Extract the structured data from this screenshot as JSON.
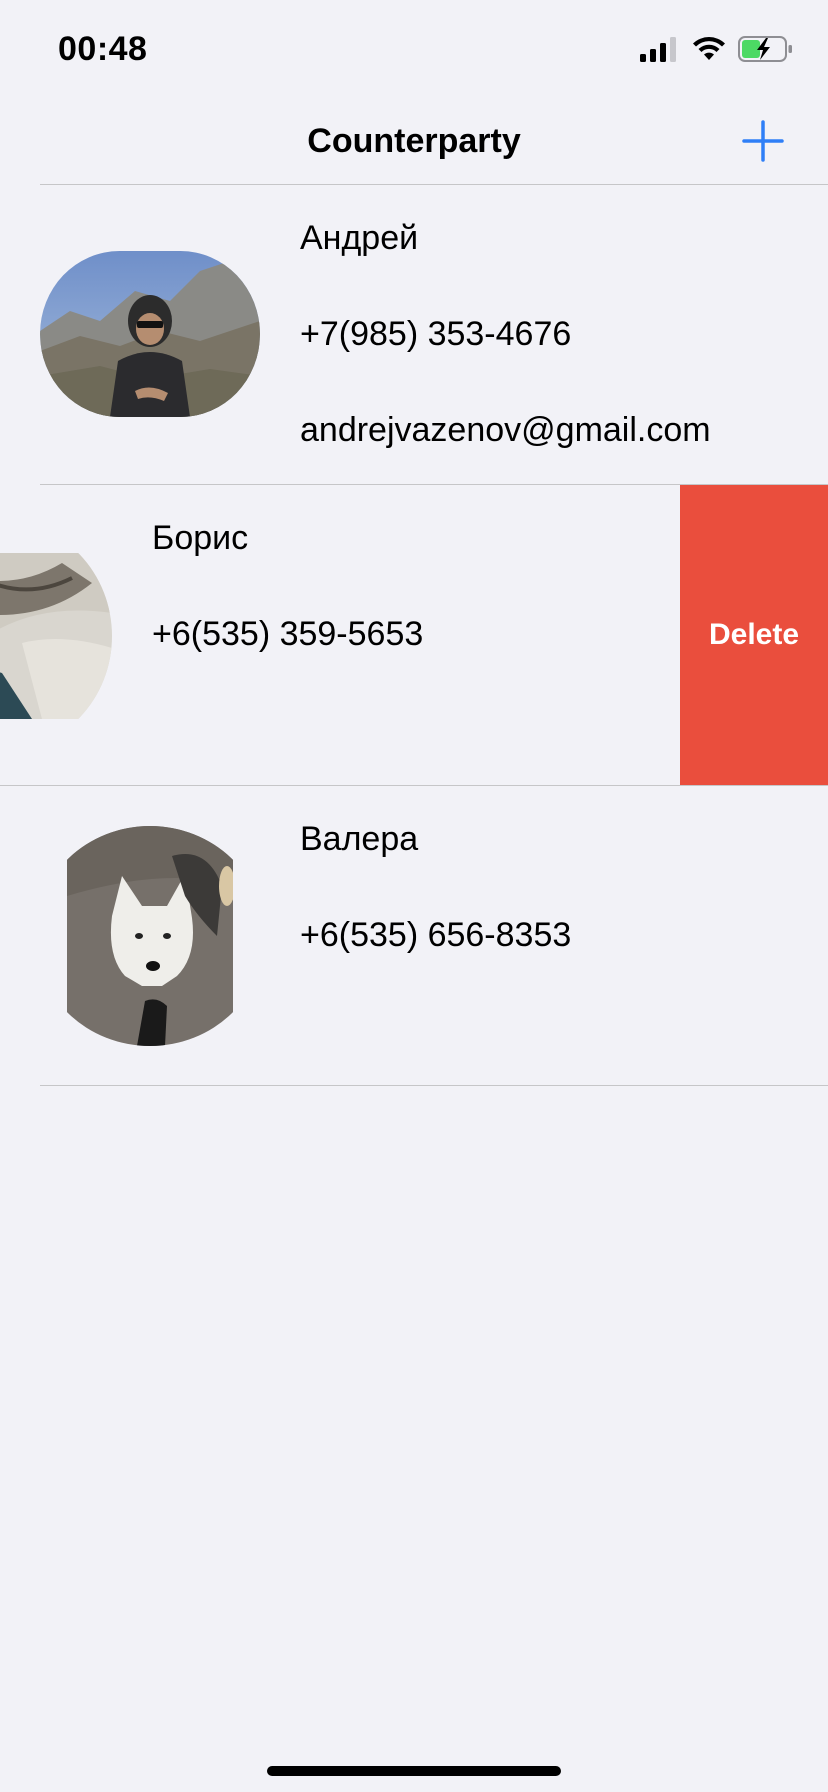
{
  "status_bar": {
    "time": "00:48",
    "icons": [
      "signal-icon",
      "wifi-icon",
      "battery-charging-icon"
    ]
  },
  "nav": {
    "title": "Counterparty",
    "add_icon": "plus-icon",
    "accent_color": "#2f7ff7"
  },
  "contacts": [
    {
      "name": "Андрей",
      "phone": "+7(985) 353-4676",
      "email": "andrejvazenov@gmail.com",
      "avatar": "photo-man-in-mountains"
    },
    {
      "name": "Борис",
      "phone": "+6(535) 359-5653",
      "avatar": "photo-cat-on-blanket",
      "swipe_action": "Delete"
    },
    {
      "name": "Валера",
      "phone": "+6(535) 656-8353",
      "avatar": "photo-husky-dog"
    }
  ],
  "colors": {
    "background": "#f2f2f7",
    "delete": "#ea4e3d",
    "separator": "#c6c6c8"
  }
}
